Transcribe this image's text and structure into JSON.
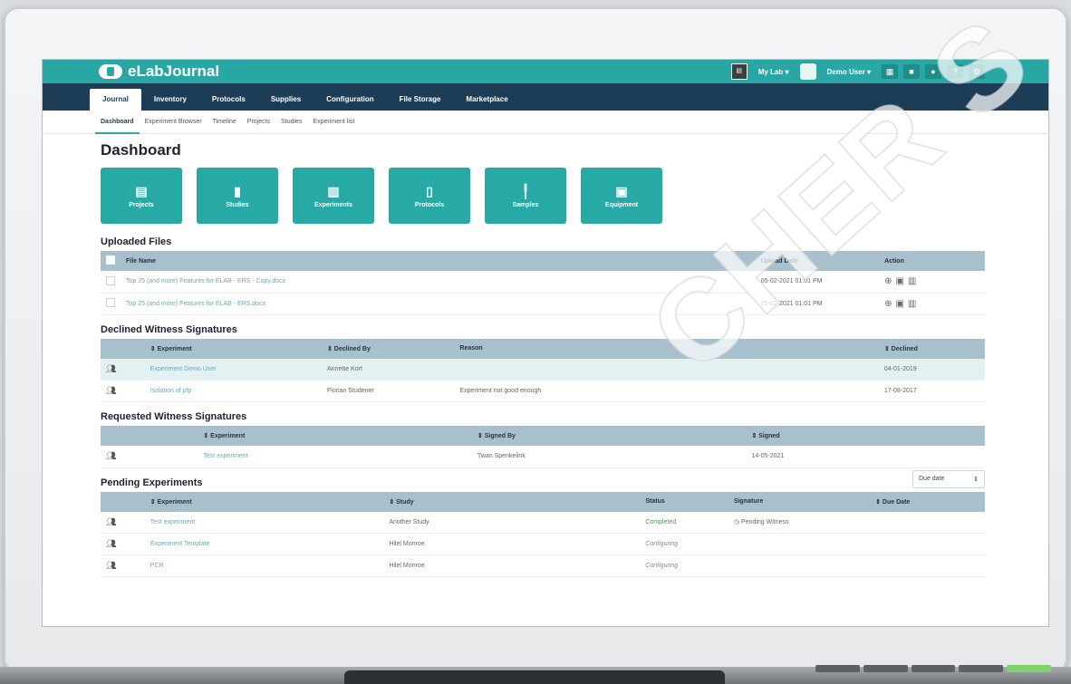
{
  "app": {
    "title": "eLabJournal"
  },
  "topbar": {
    "lab_badge": "My Lab",
    "lab_menu": "My Lab",
    "user_menu": "Demo User",
    "help_icon": "?",
    "buttons": [
      "",
      "",
      "",
      ""
    ]
  },
  "mainnav": {
    "items": [
      "Journal",
      "Inventory",
      "Protocols",
      "Supplies",
      "Configuration",
      "File Storage",
      "Marketplace"
    ]
  },
  "subnav": {
    "items": [
      "Dashboard",
      "Experiment Browser",
      "Timeline",
      "Projects",
      "Studies",
      "Experiment list"
    ]
  },
  "dashboard": {
    "title": "Dashboard",
    "tiles": [
      {
        "label": "Projects",
        "icon": "projects-icon"
      },
      {
        "label": "Studies",
        "icon": "studies-icon"
      },
      {
        "label": "Experiments",
        "icon": "experiments-icon"
      },
      {
        "label": "Protocols",
        "icon": "protocols-icon"
      },
      {
        "label": "Samples",
        "icon": "samples-icon"
      },
      {
        "label": "Equipment",
        "icon": "equipment-icon"
      }
    ]
  },
  "uploaded_files": {
    "title": "Uploaded Files",
    "columns": [
      "File Name",
      "Upload Date",
      "Action"
    ],
    "rows": [
      {
        "name": "Top 25 (and more) Features for ELAB - ERS - Copy.docx",
        "date": "05-02-2021 01:01 PM"
      },
      {
        "name": "Top 25 (and more) Features for ELAB - ERS.docx",
        "date": "05-02-2021 01:01 PM"
      }
    ]
  },
  "declined": {
    "title": "Declined Witness Signatures",
    "columns": [
      "⇕ Experiment",
      "⇕ Declined By",
      "Reason",
      "⇕ Declined"
    ],
    "rows": [
      {
        "experiment": "Experiment Demo User",
        "by": "Annette Kort",
        "reason": "",
        "date": "04-01-2019"
      },
      {
        "experiment": "Isolation of pfp",
        "by": "Florian Studener",
        "reason": "Experiment not good enough",
        "date": "17-08-2017"
      }
    ]
  },
  "requested": {
    "title": "Requested Witness Signatures",
    "columns": [
      "⇕ Experiment",
      "⇕ Signed By",
      "⇕ Signed"
    ],
    "rows": [
      {
        "experiment": "Test experiment",
        "by": "Twan Spenkelink",
        "date": "14-05-2021"
      }
    ]
  },
  "pending": {
    "title": "Pending Experiments",
    "sort_select": "Due date",
    "columns": [
      "⇕ Experiment",
      "⇕ Study",
      "Status",
      "Signature",
      "⇕ Due Date"
    ],
    "rows": [
      {
        "experiment": "Test experiment",
        "study": "Another Study",
        "status": "Completed",
        "signature": "Pending Witness"
      },
      {
        "experiment": "Experiment Template",
        "study": "Hilel Monroe",
        "status": "Configuring",
        "signature": ""
      },
      {
        "experiment": "PCR",
        "study": "Hilel Monroe",
        "status": "Configuring",
        "signature": ""
      }
    ]
  },
  "watermark": "CHER S",
  "colors": {
    "teal": "#28a7a4",
    "navy": "#1c3d55",
    "table_head": "#a8c0cc"
  }
}
